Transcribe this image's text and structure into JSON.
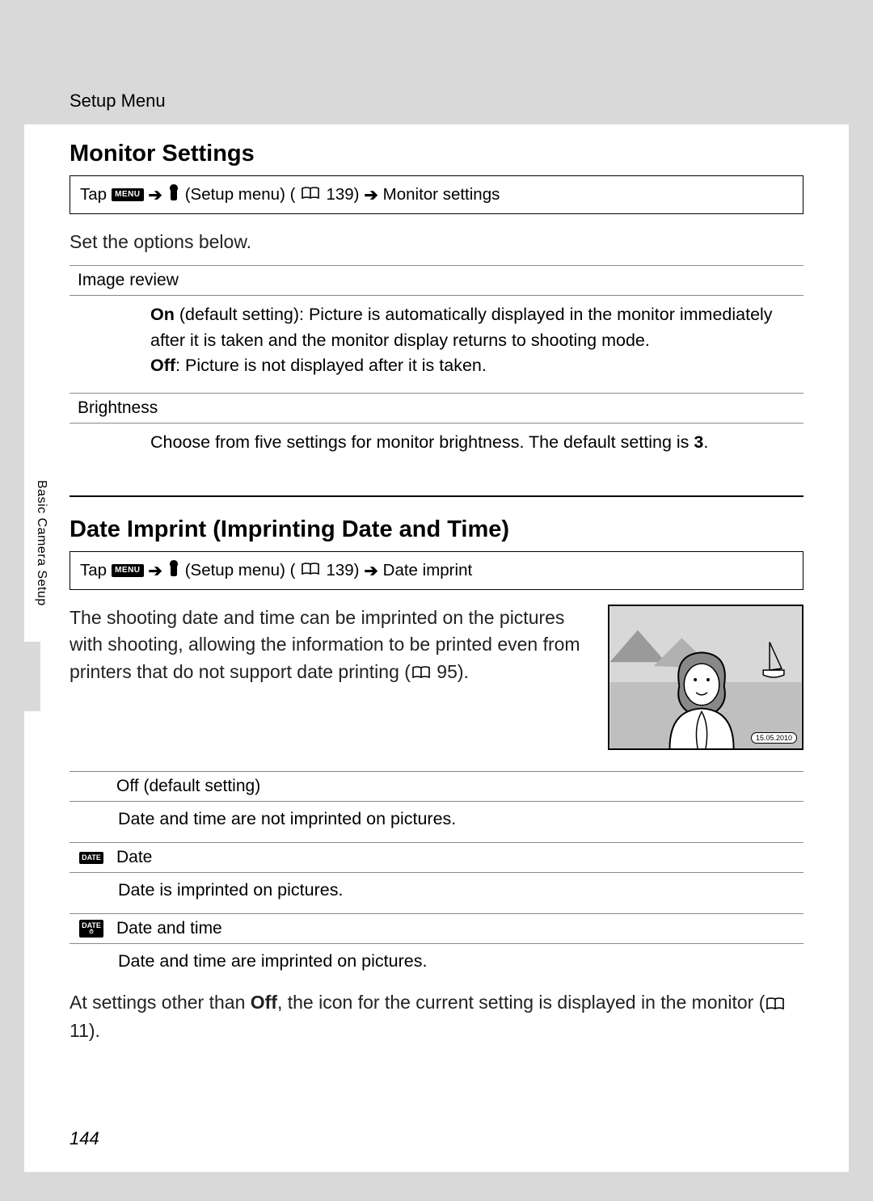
{
  "header": {
    "breadcrumb": "Setup Menu"
  },
  "side_label": "Basic Camera Setup",
  "page_number": "144",
  "section1": {
    "title": "Monitor Settings",
    "path": {
      "prefix": "Tap",
      "setup_menu": "(Setup menu) (",
      "page_ref": " 139)",
      "target": "Monitor settings"
    },
    "lead": "Set the options below.",
    "options": [
      {
        "name": "Image review",
        "body_parts": {
          "p1_strong": "On",
          "p1_rest": " (default setting): Picture is automatically displayed in the monitor immediately after it is taken and the monitor display returns to shooting mode.",
          "p2_strong": "Off",
          "p2_rest": ": Picture is not displayed after it is taken."
        }
      },
      {
        "name": "Brightness",
        "body_parts": {
          "text": "Choose from five settings for monitor brightness. The default setting is ",
          "strong": "3",
          "tail": "."
        }
      }
    ]
  },
  "section2": {
    "title": "Date Imprint (Imprinting Date and Time)",
    "path": {
      "prefix": "Tap",
      "setup_menu": "(Setup menu) (",
      "page_ref": " 139)",
      "target": "Date imprint"
    },
    "lead_pre": "The shooting date and time can be imprinted on the pictures with shooting, allowing the information to be printed even from printers that do not support date printing (",
    "lead_ref": " 95).",
    "illus_date": "15.05.2010",
    "options": [
      {
        "name": "Off (default setting)",
        "body": "Date and time are not imprinted on pictures."
      },
      {
        "name": "Date",
        "body": "Date is imprinted on pictures."
      },
      {
        "name": "Date and time",
        "body": "Date and time are imprinted on pictures."
      }
    ],
    "footer_pre": "At settings other than ",
    "footer_strong": "Off",
    "footer_mid": ", the icon for the current setting is displayed in the monitor (",
    "footer_ref": " 11)."
  }
}
